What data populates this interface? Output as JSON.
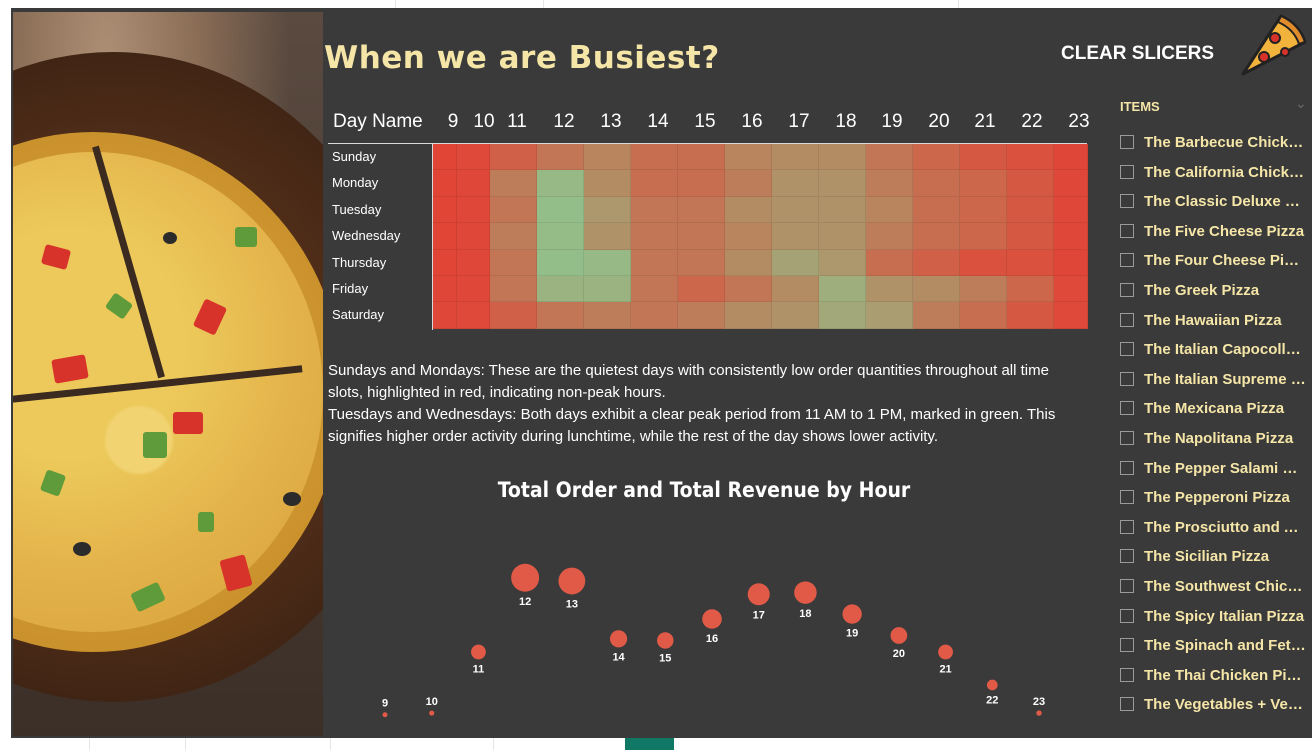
{
  "header": {
    "title": "When we are Busiest?",
    "clear_slicers_label": "CLEAR SLICERS",
    "logo_icon": "pizza-slice-icon"
  },
  "heatmap": {
    "corner_label": "Day Name",
    "hours": [
      "9",
      "10",
      "11",
      "12",
      "13",
      "14",
      "15",
      "16",
      "17",
      "18",
      "19",
      "20",
      "21",
      "22",
      "23"
    ],
    "days": [
      "Sunday",
      "Monday",
      "Tuesday",
      "Wednesday",
      "Thursday",
      "Friday",
      "Saturday"
    ],
    "colors": {
      "low": "#e34234",
      "high": "#8fc48e"
    },
    "intensity": [
      [
        0.02,
        0.05,
        0.2,
        0.35,
        0.45,
        0.3,
        0.3,
        0.45,
        0.5,
        0.5,
        0.35,
        0.25,
        0.15,
        0.1,
        0.03
      ],
      [
        0.02,
        0.04,
        0.4,
        0.9,
        0.5,
        0.3,
        0.3,
        0.4,
        0.55,
        0.55,
        0.4,
        0.3,
        0.25,
        0.15,
        0.04
      ],
      [
        0.02,
        0.04,
        0.35,
        0.95,
        0.6,
        0.35,
        0.35,
        0.5,
        0.55,
        0.55,
        0.45,
        0.3,
        0.25,
        0.15,
        0.04
      ],
      [
        0.02,
        0.04,
        0.4,
        0.92,
        0.55,
        0.35,
        0.35,
        0.45,
        0.55,
        0.55,
        0.4,
        0.3,
        0.25,
        0.15,
        0.04
      ],
      [
        0.02,
        0.04,
        0.35,
        0.95,
        0.9,
        0.35,
        0.35,
        0.5,
        0.7,
        0.6,
        0.3,
        0.2,
        0.1,
        0.1,
        0.03
      ],
      [
        0.03,
        0.04,
        0.35,
        0.85,
        0.85,
        0.35,
        0.25,
        0.35,
        0.5,
        0.8,
        0.55,
        0.5,
        0.4,
        0.25,
        0.05
      ],
      [
        0.04,
        0.05,
        0.2,
        0.35,
        0.4,
        0.35,
        0.4,
        0.5,
        0.55,
        0.75,
        0.65,
        0.4,
        0.3,
        0.15,
        0.05
      ]
    ]
  },
  "description": {
    "paragraph1": "Sundays and Mondays: These are the quietest days with consistently low order quantities throughout all time slots, highlighted in red, indicating non-peak hours.",
    "paragraph2": "Tuesdays and Wednesdays: Both days exhibit a clear peak period from 11 AM to 1 PM, marked in green. This signifies higher order activity during lunchtime, while the rest of the day shows lower activity."
  },
  "chart_data": {
    "type": "scatter",
    "title": "Total Order and Total Revenue by Hour",
    "xlabel": "",
    "ylabel": "",
    "color": "#e05a47",
    "points": [
      {
        "label": "9",
        "x": 9,
        "y": 0.02,
        "size": 0.04
      },
      {
        "label": "10",
        "x": 10,
        "y": 0.03,
        "size": 0.05
      },
      {
        "label": "11",
        "x": 11,
        "y": 0.4,
        "size": 0.45
      },
      {
        "label": "12",
        "x": 12,
        "y": 0.85,
        "size": 1.0
      },
      {
        "label": "13",
        "x": 13,
        "y": 0.83,
        "size": 0.95
      },
      {
        "label": "14",
        "x": 14,
        "y": 0.48,
        "size": 0.55
      },
      {
        "label": "15",
        "x": 15,
        "y": 0.47,
        "size": 0.52
      },
      {
        "label": "16",
        "x": 16,
        "y": 0.6,
        "size": 0.65
      },
      {
        "label": "17",
        "x": 17,
        "y": 0.75,
        "size": 0.75
      },
      {
        "label": "18",
        "x": 18,
        "y": 0.76,
        "size": 0.77
      },
      {
        "label": "19",
        "x": 19,
        "y": 0.63,
        "size": 0.64
      },
      {
        "label": "20",
        "x": 20,
        "y": 0.5,
        "size": 0.53
      },
      {
        "label": "21",
        "x": 21,
        "y": 0.4,
        "size": 0.45
      },
      {
        "label": "22",
        "x": 22,
        "y": 0.2,
        "size": 0.28
      },
      {
        "label": "23",
        "x": 23,
        "y": 0.03,
        "size": 0.06
      }
    ]
  },
  "slicer": {
    "title": "ITEMS",
    "items": [
      "The Barbecue Chicken Pizza",
      "The California Chicken Pizza",
      "The Classic Deluxe Pizza",
      "The Five Cheese Pizza",
      "The Four Cheese Pizza",
      "The Greek Pizza",
      "The Hawaiian Pizza",
      "The Italian Capocollo Pizza",
      "The Italian Supreme Pizza",
      "The Mexicana Pizza",
      "The Napolitana Pizza",
      "The Pepper Salami Pizza",
      "The Pepperoni Pizza",
      "The Prosciutto and Arugula Pizza",
      "The Sicilian Pizza",
      "The Southwest Chicken Pizza",
      "The Spicy Italian Pizza",
      "The Spinach and Feta Pizza",
      "The Thai Chicken Pizza",
      "The Vegetables + Vegetables Pizza"
    ]
  }
}
